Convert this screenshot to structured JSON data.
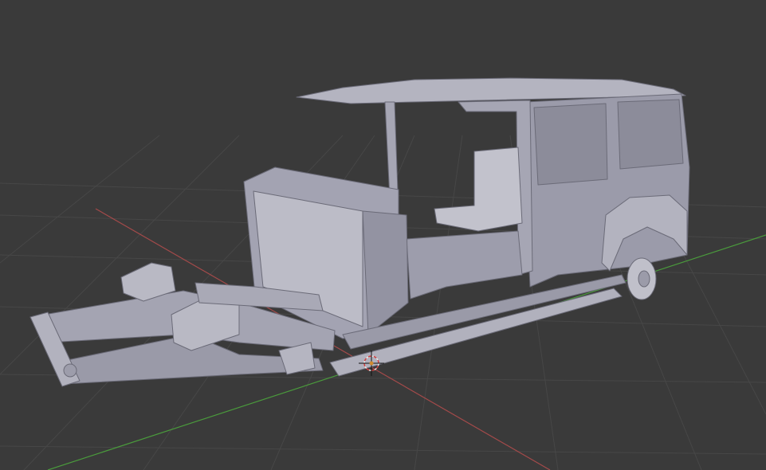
{
  "app": "3D viewport",
  "viewport": {
    "background": "#3a3a3a",
    "grid_color": "#4a4a4a",
    "x_axis_color": "#a34a4a",
    "y_axis_color": "#4a9a3c"
  },
  "scene": {
    "object": "vehicle-body-and-chassis-mesh",
    "shade": "#a9a9b6",
    "shade_dark": "#7d7d8c",
    "shade_light": "#c6c6d0",
    "cursor_icon": "3d-cursor-icon"
  }
}
